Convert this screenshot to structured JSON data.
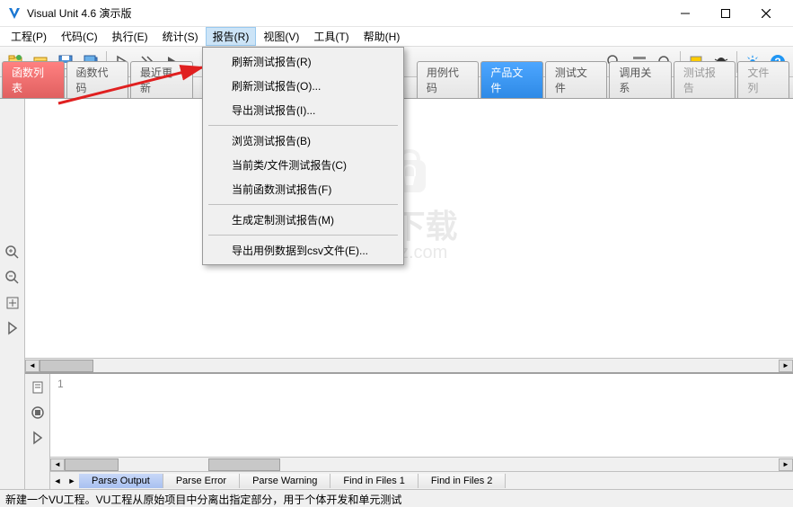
{
  "titlebar": {
    "title": "Visual Unit 4.6 演示版"
  },
  "menu": {
    "items": [
      "工程(P)",
      "代码(C)",
      "执行(E)",
      "统计(S)",
      "报告(R)",
      "视图(V)",
      "工具(T)",
      "帮助(H)"
    ],
    "active_index": 4
  },
  "tabs": {
    "items": [
      {
        "label": "函数列表",
        "style": "red"
      },
      {
        "label": "函数代码",
        "style": ""
      },
      {
        "label": "最近更新",
        "style": ""
      },
      {
        "label": "用例代码",
        "style": ""
      },
      {
        "label": "产品文件",
        "style": "blue"
      },
      {
        "label": "测试文件",
        "style": ""
      },
      {
        "label": "调用关系",
        "style": ""
      },
      {
        "label": "测试报告",
        "style": "gray"
      },
      {
        "label": "文件列",
        "style": "gray"
      }
    ]
  },
  "dropdown": {
    "group1": [
      "刷新测试报告(R)",
      "刷新测试报告(O)...",
      "导出测试报告(I)..."
    ],
    "group2": [
      "浏览测试报告(B)",
      "当前类/文件测试报告(C)",
      "当前函数测试报告(F)"
    ],
    "group3": [
      "生成定制测试报告(M)"
    ],
    "group4": [
      "导出用例数据到csv文件(E)..."
    ]
  },
  "watermark": {
    "main": "安下载",
    "sub": "anxz.com"
  },
  "lower": {
    "line_number": "1"
  },
  "bottom_tabs": [
    "Parse Output",
    "Parse Error",
    "Parse Warning",
    "Find in Files 1",
    "Find in Files 2"
  ],
  "statusbar": {
    "text": "新建一个VU工程。VU工程从原始项目中分离出指定部分，用于个体开发和单元测试"
  }
}
